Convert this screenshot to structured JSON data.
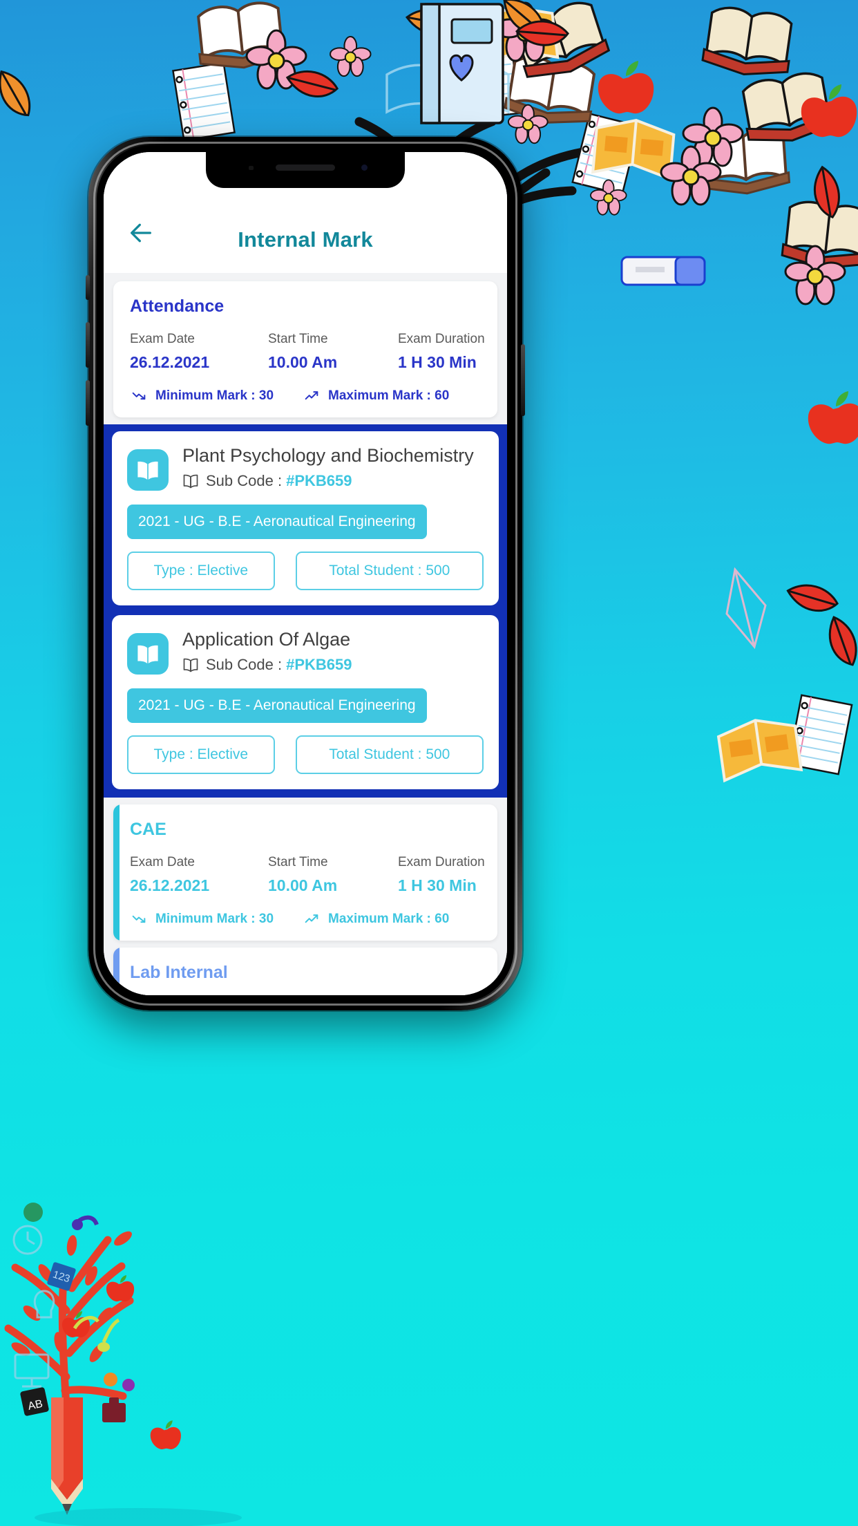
{
  "app": {
    "title": "Internal Mark",
    "back_icon": "arrow-left-icon",
    "accent_teal": "#12889a",
    "accent_indigo": "#2a35c8",
    "accent_cyan": "#3fc6e0",
    "accent_softblue": "#6f9cf0",
    "band_blue": "#1230b5"
  },
  "sections": [
    {
      "id": "attendance",
      "title": "Attendance",
      "theme": "indigo",
      "labels": {
        "exam_date": "Exam Date",
        "start_time": "Start Time",
        "exam_duration": "Exam Duration"
      },
      "values": {
        "exam_date": "26.12.2021",
        "start_time": "10.00 Am",
        "exam_duration": "1 H 30 Min"
      },
      "minimum_mark": "Minimum Mark : 30",
      "maximum_mark": "Maximum Mark : 60",
      "min_icon": "trending-down-icon",
      "max_icon": "trending-up-icon"
    },
    {
      "id": "cae",
      "title": "CAE",
      "theme": "cyan",
      "labels": {
        "exam_date": "Exam Date",
        "start_time": "Start Time",
        "exam_duration": "Exam Duration"
      },
      "values": {
        "exam_date": "26.12.2021",
        "start_time": "10.00 Am",
        "exam_duration": "1 H 30 Min"
      },
      "minimum_mark": "Minimum Mark : 30",
      "maximum_mark": "Maximum Mark : 60",
      "min_icon": "trending-down-icon",
      "max_icon": "trending-up-icon"
    },
    {
      "id": "lab-internal",
      "title": "Lab Internal",
      "theme": "softblue"
    }
  ],
  "subjects": [
    {
      "name": "Plant Psychology and Biochemistry",
      "icon": "open-book-icon",
      "sub_code_label": "Sub Code :",
      "sub_code_value": "#PKB659",
      "sub_code_icon": "book-outline-icon",
      "course": "2021 - UG - B.E - Aeronautical Engineering",
      "type": "Type : Elective",
      "total_student": "Total Student : 500"
    },
    {
      "name": "Application Of Algae",
      "icon": "open-book-icon",
      "sub_code_label": "Sub Code :",
      "sub_code_value": "#PKB659",
      "sub_code_icon": "book-outline-icon",
      "course": "2021 - UG - B.E - Aeronautical Engineering",
      "type": "Type : Elective",
      "total_student": "Total Student : 500"
    }
  ]
}
